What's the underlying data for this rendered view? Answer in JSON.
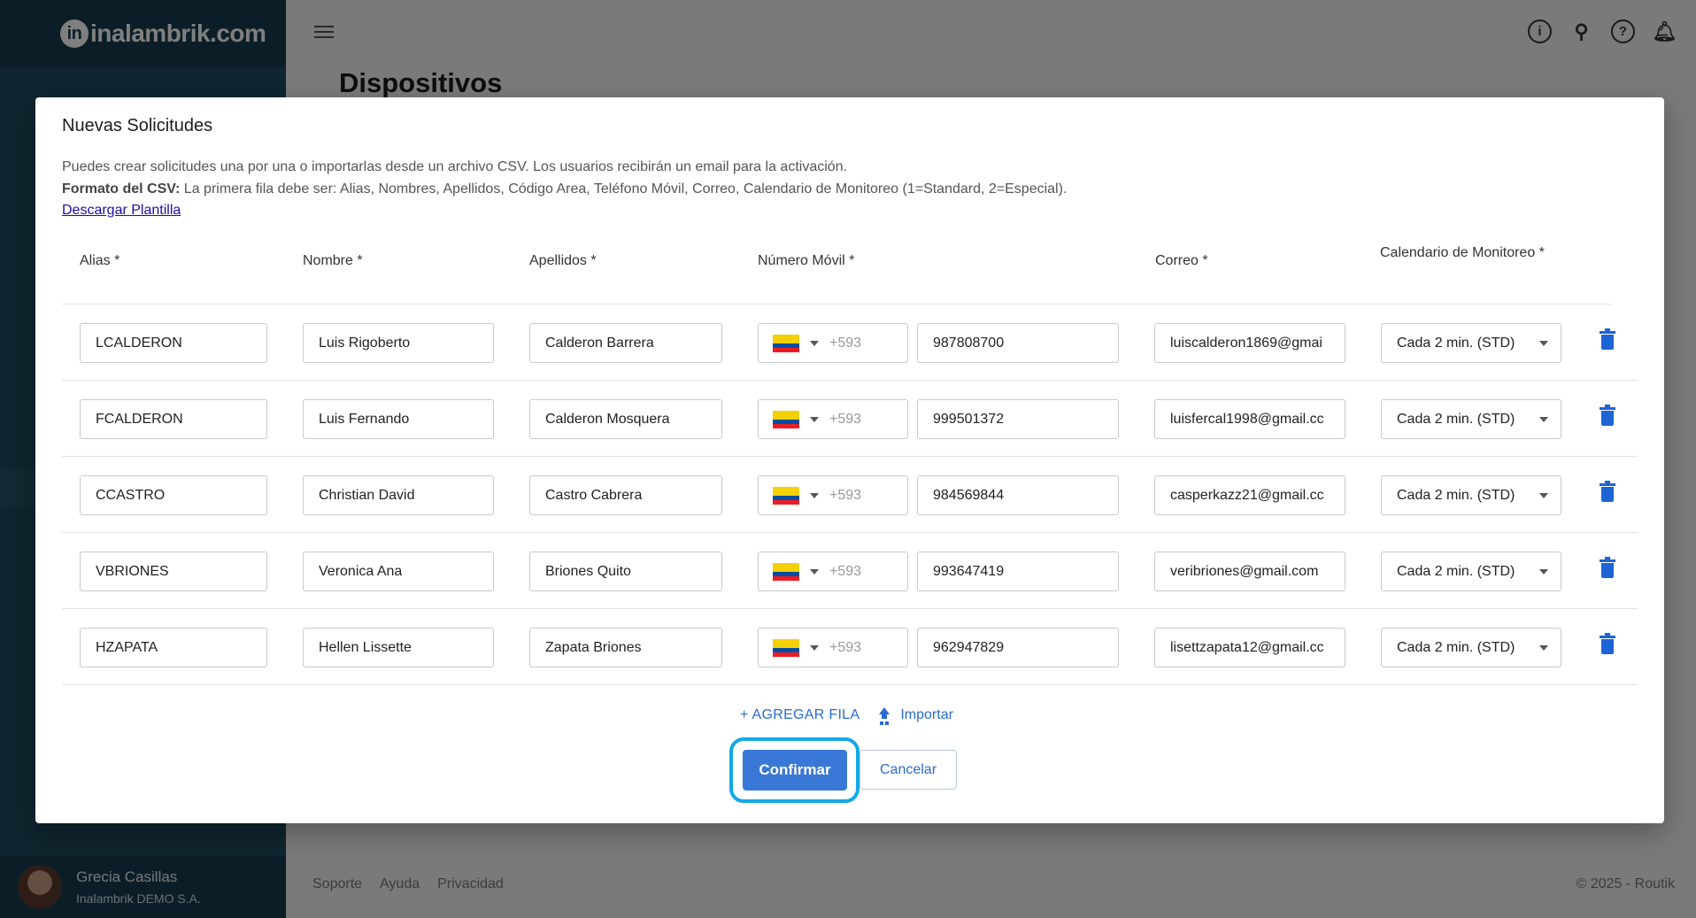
{
  "app": {
    "brand": "inalambrik.com",
    "page_title": "Dispositivos"
  },
  "user": {
    "name": "Grecia Casillas",
    "org": "Inalambrik DEMO S.A."
  },
  "footer": {
    "links": [
      "Soporte",
      "Ayuda",
      "Privacidad"
    ],
    "copyright": "© 2025 - Routik"
  },
  "modal": {
    "title": "Nuevas Solicitudes",
    "description": "Puedes crear solicitudes una por una o importarlas desde un archivo CSV. Los usuarios recibirán un email para la activación.",
    "format_label": "Formato del CSV:",
    "format_text": " La primera fila debe ser: Alias, Nombres, Apellidos, Código Area, Teléfono Móvil, Correo, Calendario de Monitoreo (1=Standard, 2=Especial).",
    "template_link": "Descargar Plantilla",
    "columns": {
      "alias": "Alias *",
      "nombre": "Nombre *",
      "apellidos": "Apellidos *",
      "movil": "Número Móvil *",
      "correo": "Correo *",
      "calendario": "Calendario de Monitoreo *"
    },
    "rows": [
      {
        "alias": "LCALDERON",
        "nombre": "Luis Rigoberto",
        "apellidos": "Calderon Barrera",
        "dial": "+593",
        "movil": "987808700",
        "correo": "luiscalderon1869@gmai",
        "calendario": "Cada 2 min. (STD)"
      },
      {
        "alias": "FCALDERON",
        "nombre": "Luis Fernando",
        "apellidos": "Calderon Mosquera",
        "dial": "+593",
        "movil": "999501372",
        "correo": "luisfercal1998@gmail.cc",
        "calendario": "Cada 2 min. (STD)"
      },
      {
        "alias": "CCASTRO",
        "nombre": "Christian David",
        "apellidos": "Castro Cabrera",
        "dial": "+593",
        "movil": "984569844",
        "correo": "casperkazz21@gmail.cc",
        "calendario": "Cada 2 min. (STD)"
      },
      {
        "alias": "VBRIONES",
        "nombre": "Veronica Ana",
        "apellidos": "Briones Quito",
        "dial": "+593",
        "movil": "993647419",
        "correo": "veribriones@gmail.com",
        "calendario": "Cada 2 min. (STD)"
      },
      {
        "alias": "HZAPATA",
        "nombre": "Hellen Lissette",
        "apellidos": "Zapata Briones",
        "dial": "+593",
        "movil": "962947829",
        "correo": "lisettzapata12@gmail.cc",
        "calendario": "Cada 2 min. (STD)"
      }
    ],
    "add_row": "+ AGREGAR FILA",
    "import": "Importar",
    "confirm": "Confirmar",
    "cancel": "Cancelar"
  },
  "colors": {
    "sidebar": "#1e4a5e",
    "primary": "#3a78d8",
    "highlight_ring": "#13a8e8",
    "trash": "#1d63d6"
  }
}
